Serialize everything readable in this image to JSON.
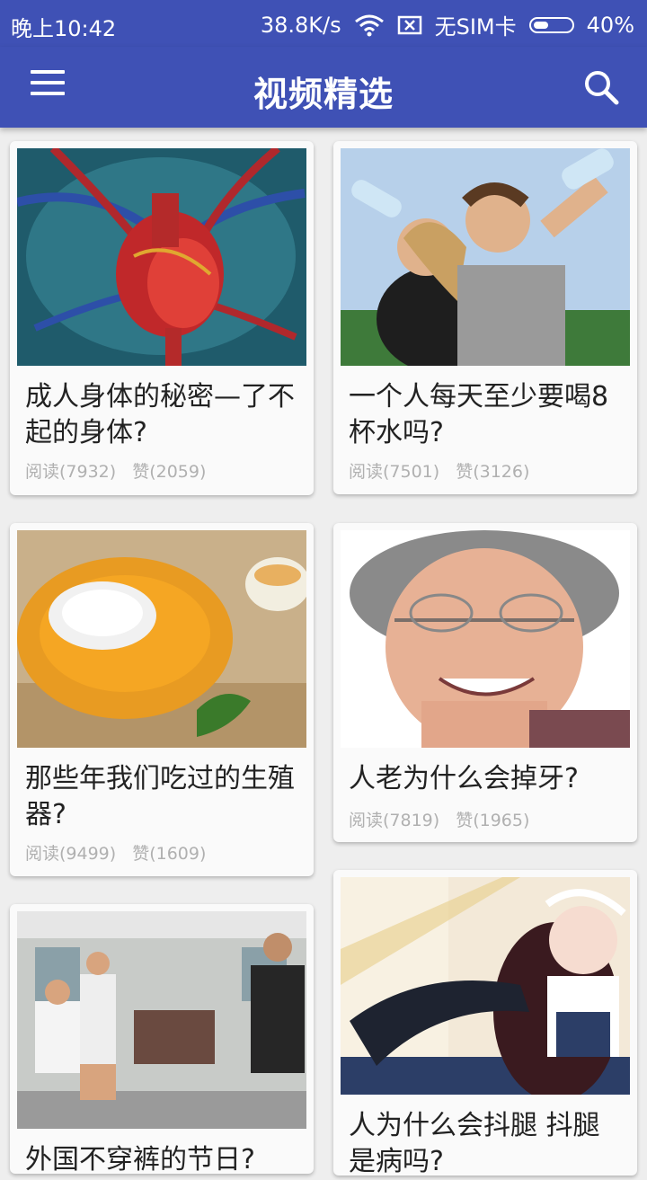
{
  "status": {
    "time": "晚上10:42",
    "speed": "38.8K/s",
    "sim": "无SIM卡",
    "battery": "40%",
    "battery_level": 0.4
  },
  "header": {
    "title": "视频精选"
  },
  "cards": [
    {
      "title": " 成人身体的秘密—了不起的身体?",
      "reads": "阅读(7932)",
      "likes": "赞(2059)"
    },
    {
      "title": "一个人每天至少要喝8杯水吗?",
      "reads": "阅读(7501)",
      "likes": "赞(3126)"
    },
    {
      "title": "那些年我们吃过的生殖器?",
      "reads": "阅读(9499)",
      "likes": "赞(1609)"
    },
    {
      "title": "人老为什么会掉牙?",
      "reads": "阅读(7819)",
      "likes": "赞(1965)"
    },
    {
      "title": "外国不穿裤的节日?"
    },
    {
      "title": "人为什么会抖腿 抖腿是病吗?"
    }
  ],
  "colors": {
    "primary": "#3f51b5",
    "background": "#eeeeee",
    "card": "#fafafa",
    "meta": "#b0b0b0"
  },
  "icons": {
    "menu": "menu-icon",
    "search": "search-icon",
    "wifi": "wifi-icon",
    "sim": "no-sim-icon",
    "battery": "battery-icon"
  }
}
